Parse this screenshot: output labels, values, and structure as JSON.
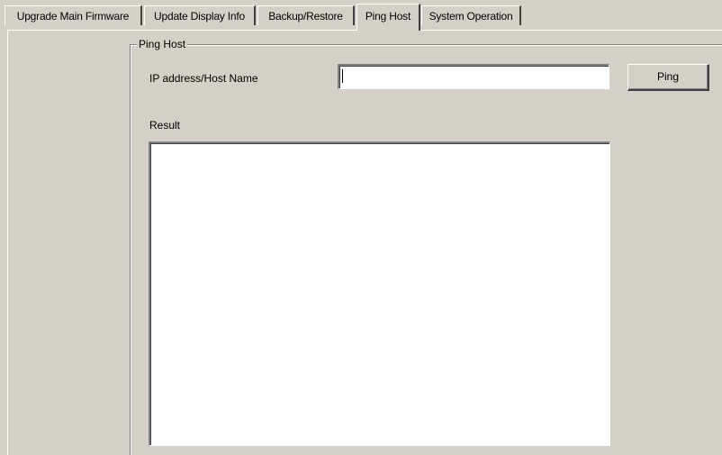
{
  "tabs": [
    {
      "label": "Upgrade Main Firmware",
      "active": false
    },
    {
      "label": "Update Display Info",
      "active": false
    },
    {
      "label": "Backup/Restore",
      "active": false
    },
    {
      "label": "Ping Host",
      "active": true
    },
    {
      "label": "System Operation",
      "active": false
    }
  ],
  "ping_host": {
    "group_title": "Ping Host",
    "ip_label": "IP address/Host Name",
    "ip_value": "",
    "ping_button": "Ping",
    "result_label": "Result",
    "result_value": ""
  },
  "colors": {
    "background": "#d4d0c8",
    "field": "#ffffff",
    "shadow": "#808080",
    "dark_shadow": "#404040",
    "highlight": "#ffffff"
  }
}
